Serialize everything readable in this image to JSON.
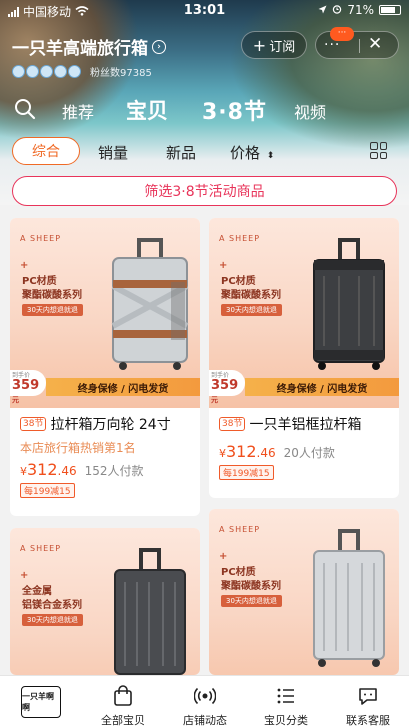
{
  "status_bar": {
    "carrier": "中国移动",
    "time": "13:01",
    "battery": "71%"
  },
  "header": {
    "shop_name": "一只羊高端旅行箱",
    "fans": "粉丝数97385",
    "subscribe_label": "订阅",
    "more_badge": "···"
  },
  "nav": {
    "tabs": [
      "推荐",
      "宝贝",
      "3·8节",
      "视频"
    ],
    "active": "宝贝"
  },
  "filters": {
    "items": [
      "综合",
      "销量",
      "新品",
      "价格"
    ],
    "active": "综合"
  },
  "banner": "筛选3·8节活动商品",
  "products": [
    {
      "brand": "A SHEEP",
      "plus": "+",
      "material_1": "PC材质",
      "material_2": "聚酯碳酸系列",
      "refund": "30天内想退就退",
      "tag_label": "到手价",
      "tag_price": "359",
      "tag_unit": "元",
      "warranty": "终身保修 / 闪电发货",
      "badge": "38节",
      "title": "拉杆箱万向轮 24寸",
      "subtitle": "本店旅行箱热销第1名",
      "price_int": "312",
      "price_dec": ".46",
      "sold": "152人付款",
      "coupon": "每199减15"
    },
    {
      "brand": "A SHEEP",
      "plus": "+",
      "material_1": "PC材质",
      "material_2": "聚酯碳酸系列",
      "refund": "30天内想退就退",
      "tag_label": "到手价",
      "tag_price": "359",
      "tag_unit": "元",
      "warranty": "终身保修 / 闪电发货",
      "badge": "38节",
      "title": "一只羊铝框拉杆箱",
      "subtitle": "",
      "price_int": "312",
      "price_dec": ".46",
      "sold": "20人付款",
      "coupon": "每199减15"
    },
    {
      "brand": "A SHEEP",
      "plus": "+",
      "material_1": "全金属",
      "material_2": "铝镁合金系列",
      "refund": "30天内想退就退"
    },
    {
      "brand": "A SHEEP",
      "plus": "+",
      "material_1": "PC材质",
      "material_2": "聚酯碳酸系列",
      "refund": "30天内想退就退"
    }
  ],
  "tabbar": {
    "logo_text": "一只羊啊啊",
    "items": [
      "全部宝贝",
      "店铺动态",
      "宝贝分类",
      "联系客服"
    ]
  },
  "colors": {
    "accent": "#f06a26",
    "banner": "#e8345a",
    "price": "#f04f1c"
  }
}
